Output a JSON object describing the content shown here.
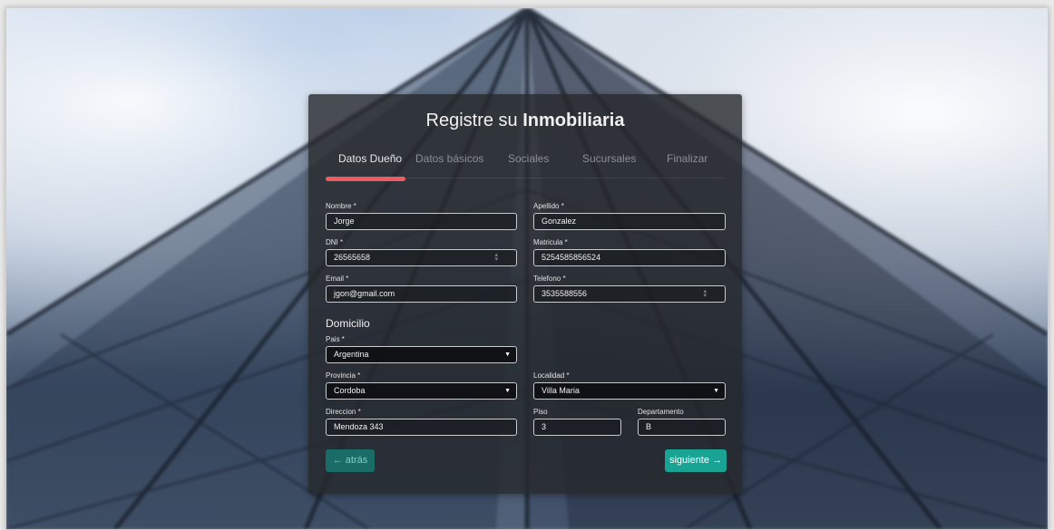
{
  "form": {
    "title_light": "Registre su",
    "title_bold": "Inmobiliaria",
    "tabs": [
      "Datos Dueño",
      "Datos básicos",
      "Sociales",
      "Sucursales",
      "Finalizar"
    ],
    "active_tab": 0,
    "fields": {
      "nombre": {
        "label": "Nombre *",
        "value": "Jorge"
      },
      "apellido": {
        "label": "Apellido *",
        "value": "Gonzalez"
      },
      "dni": {
        "label": "DNI *",
        "value": "26565658"
      },
      "matricula": {
        "label": "Matricula *",
        "value": "5254585856524"
      },
      "email": {
        "label": "Email *",
        "value": "jgon@gmail.com"
      },
      "telefono": {
        "label": "Telefono *",
        "value": "3535588556"
      },
      "pais": {
        "label": "Pais *",
        "value": "Argentina"
      },
      "provincia": {
        "label": "Provincia *",
        "value": "Cordoba"
      },
      "localidad": {
        "label": "Localidad *",
        "value": "Villa Maria"
      },
      "direccion": {
        "label": "Direccion *",
        "value": "Mendoza 343"
      },
      "piso": {
        "label": "Piso",
        "value": "3"
      },
      "departamento": {
        "label": "Departamento",
        "value": "B"
      }
    },
    "section_domicilio": "Domicilio",
    "back_label": "← atrás",
    "next_label": "siguiente →"
  },
  "colors": {
    "tab_indicator": "#ef5b62",
    "back_button": "#1a6d66",
    "next_button": "#19a394",
    "card_bg": "#26282c"
  },
  "background": {
    "icon": "glass-skyscraper-photo"
  }
}
